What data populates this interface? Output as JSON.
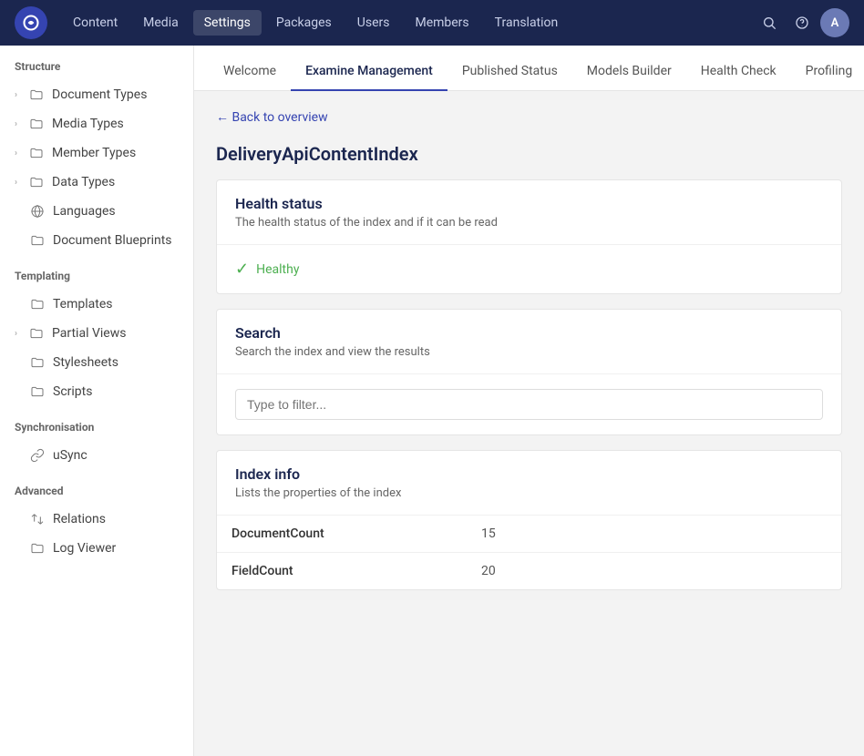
{
  "topnav": {
    "logo_label": "U",
    "items": [
      {
        "label": "Content",
        "active": false
      },
      {
        "label": "Media",
        "active": false
      },
      {
        "label": "Settings",
        "active": true
      },
      {
        "label": "Packages",
        "active": false
      },
      {
        "label": "Users",
        "active": false
      },
      {
        "label": "Members",
        "active": false
      },
      {
        "label": "Translation",
        "active": false
      }
    ],
    "avatar_label": "A"
  },
  "sidebar": {
    "sections": [
      {
        "title": "Structure",
        "items": [
          {
            "label": "Document Types",
            "icon": "folder",
            "has_arrow": true
          },
          {
            "label": "Media Types",
            "icon": "folder",
            "has_arrow": true
          },
          {
            "label": "Member Types",
            "icon": "folder",
            "has_arrow": true
          },
          {
            "label": "Data Types",
            "icon": "folder",
            "has_arrow": true
          },
          {
            "label": "Languages",
            "icon": "globe",
            "has_arrow": false
          },
          {
            "label": "Document Blueprints",
            "icon": "folder",
            "has_arrow": false
          }
        ]
      },
      {
        "title": "Templating",
        "items": [
          {
            "label": "Templates",
            "icon": "folder",
            "has_arrow": false
          },
          {
            "label": "Partial Views",
            "icon": "folder",
            "has_arrow": true
          },
          {
            "label": "Stylesheets",
            "icon": "folder",
            "has_arrow": false
          },
          {
            "label": "Scripts",
            "icon": "folder",
            "has_arrow": false
          }
        ]
      },
      {
        "title": "Synchronisation",
        "items": [
          {
            "label": "uSync",
            "icon": "link",
            "has_arrow": false
          }
        ]
      },
      {
        "title": "Advanced",
        "items": [
          {
            "label": "Relations",
            "icon": "arrows",
            "has_arrow": false
          },
          {
            "label": "Log Viewer",
            "icon": "folder",
            "has_arrow": false
          }
        ]
      }
    ]
  },
  "subtabs": {
    "items": [
      {
        "label": "Welcome",
        "active": false
      },
      {
        "label": "Examine Management",
        "active": true
      },
      {
        "label": "Published Status",
        "active": false
      },
      {
        "label": "Models Builder",
        "active": false
      },
      {
        "label": "Health Check",
        "active": false
      },
      {
        "label": "Profiling",
        "active": false
      }
    ]
  },
  "back_link": "← Back to overview",
  "index_title": "DeliveryApiContentIndex",
  "health_section": {
    "title": "Health status",
    "subtitle": "The health status of the index and if it can be read",
    "status": "Healthy"
  },
  "search_section": {
    "title": "Search",
    "subtitle": "Search the index and view the results",
    "placeholder": "Type to filter..."
  },
  "index_info_section": {
    "title": "Index info",
    "subtitle": "Lists the properties of the index",
    "rows": [
      {
        "key": "DocumentCount",
        "value": "15"
      },
      {
        "key": "FieldCount",
        "value": "20"
      }
    ]
  }
}
